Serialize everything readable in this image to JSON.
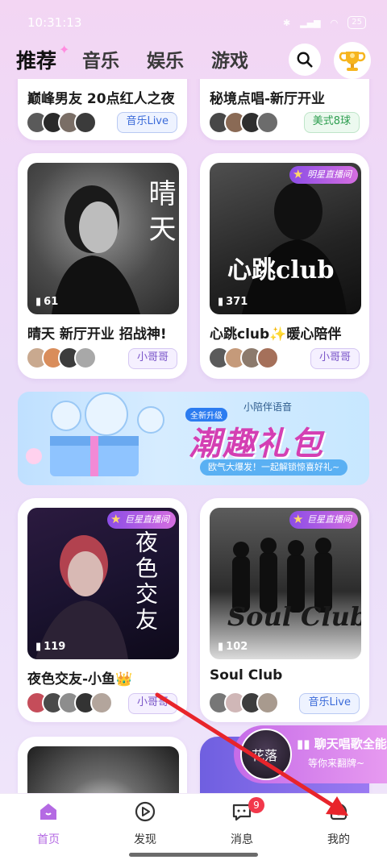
{
  "status_bar": {
    "time": "10:31:13",
    "battery": "25"
  },
  "top_nav": {
    "tabs": [
      {
        "label": "推荐",
        "active": true
      },
      {
        "label": "音乐",
        "active": false
      },
      {
        "label": "娱乐",
        "active": false
      },
      {
        "label": "游戏",
        "active": false
      }
    ],
    "search_icon": "search-icon",
    "trophy_icon": "trophy-icon"
  },
  "cards": [
    {
      "title": "巅峰男友 20点红人之夜",
      "tag": "音乐Live"
    },
    {
      "title": "秘境点唱-新厅开业",
      "tag": "美式8球"
    },
    {
      "title": "晴天 新厅开业 招战神!",
      "tag": "小哥哥",
      "count": "61",
      "art_text": "晴天"
    },
    {
      "title": "心跳club✨暖心陪伴",
      "tag": "小哥哥",
      "count": "371",
      "art_text": "心跳club",
      "badge": "明星直播间"
    },
    {
      "title": "夜色交友-小鱼👑",
      "tag": "小哥哥",
      "count": "119",
      "art_text": "夜色交友",
      "badge": "巨星直播间"
    },
    {
      "title": "Soul Club",
      "tag": "音乐Live",
      "count": "102",
      "art_text": "Soul Club",
      "badge": "巨星直播间"
    }
  ],
  "banner": {
    "brand": "小陪伴语音",
    "new_label": "全新升级",
    "title": "潮趣礼包",
    "subtitle": "欧气大爆发！一起解锁惊喜好礼~"
  },
  "promo": {
    "title": "聊天唱歌全能",
    "subtitle": "等你来翻牌~",
    "avatar_text": "花落"
  },
  "bottom_nav": {
    "items": [
      {
        "label": "首页",
        "icon": "home-icon",
        "active": true
      },
      {
        "label": "发现",
        "icon": "discover-icon",
        "active": false
      },
      {
        "label": "消息",
        "icon": "message-icon",
        "active": false,
        "badge": "9"
      },
      {
        "label": "我的",
        "icon": "profile-icon",
        "active": false
      }
    ]
  },
  "colors": {
    "accent": "#b46ae3",
    "background": "#eedbf7"
  }
}
